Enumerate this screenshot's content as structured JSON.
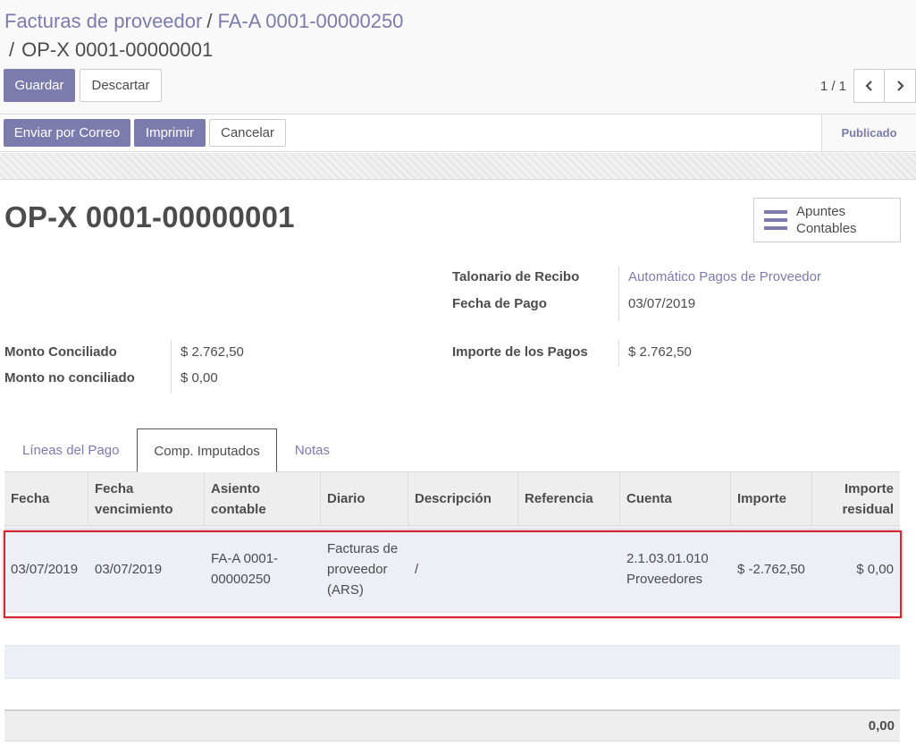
{
  "breadcrumb": {
    "items": [
      "Facturas de proveedor",
      "FA-A 0001-00000250"
    ],
    "separator": "/",
    "current": "OP-X 0001-00000001"
  },
  "toolbar": {
    "save_label": "Guardar",
    "discard_label": "Descartar"
  },
  "pager": {
    "value": "1 / 1"
  },
  "statusbar": {
    "buttons": [
      "Enviar por Correo",
      "Imprimir",
      "Cancelar"
    ],
    "state": "Publicado"
  },
  "record": {
    "title": "OP-X 0001-00000001",
    "smart_button_label": "Apuntes Contables",
    "fields": {
      "talonario_label": "Talonario de Recibo",
      "talonario_value": "Automático Pagos de Proveedor",
      "fecha_pago_label": "Fecha de Pago",
      "fecha_pago_value": "03/07/2019",
      "monto_conciliado_label": "Monto Conciliado",
      "monto_conciliado_value": "$ 2.762,50",
      "monto_no_conciliado_label": "Monto no conciliado",
      "monto_no_conciliado_value": "$ 0,00",
      "importe_pagos_label": "Importe de los Pagos",
      "importe_pagos_value": "$ 2.762,50"
    }
  },
  "tabs": [
    "Líneas del Pago",
    "Comp. Imputados",
    "Notas"
  ],
  "active_tab": "Comp. Imputados",
  "table": {
    "columns": [
      "Fecha",
      "Fecha vencimiento",
      "Asiento contable",
      "Diario",
      "Descripción",
      "Referencia",
      "Cuenta",
      "Importe",
      "Importe residual"
    ],
    "rows": [
      {
        "fecha": "03/07/2019",
        "fecha_vencimiento": "03/07/2019",
        "asiento": "FA-A 0001-00000250",
        "diario": "Facturas de proveedor (ARS)",
        "descripcion": "/",
        "referencia": "",
        "cuenta": "2.1.03.01.010 Proveedores",
        "importe": "$ -2.762,50",
        "importe_residual": "$ 0,00"
      }
    ],
    "total": "0,00"
  },
  "colors": {
    "brand": "#7c7bad",
    "highlight": "#d0282e"
  }
}
